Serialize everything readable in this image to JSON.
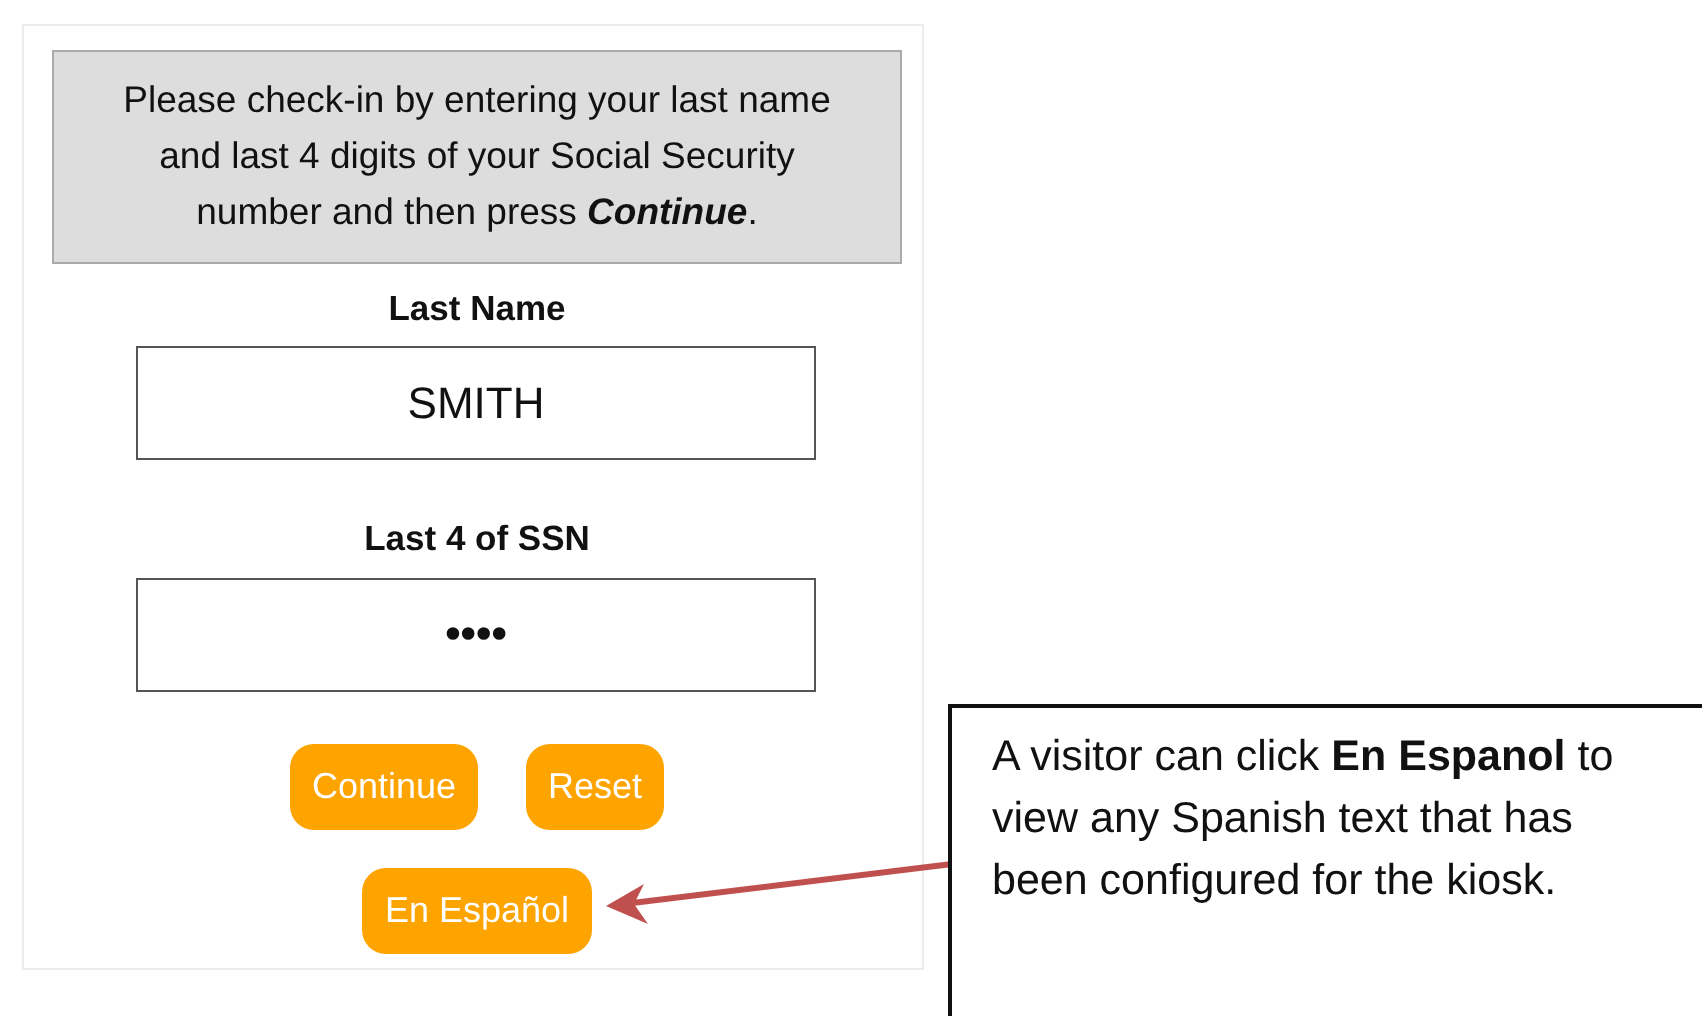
{
  "instructions": "Please check-in by entering your last name and last 4 digits of your Social Security number and then press **Continue**.",
  "fields": [
    {
      "label": "Last Name",
      "value": "SMITH"
    },
    {
      "label": "Last 4 of SSN",
      "value": "••••"
    }
  ],
  "buttons": [
    "Continue",
    "Reset"
  ],
  "language_button": "En Español",
  "callout": "A visitor can click **En Espanol** to view any Spanish text that has been configured for the kiosk."
}
